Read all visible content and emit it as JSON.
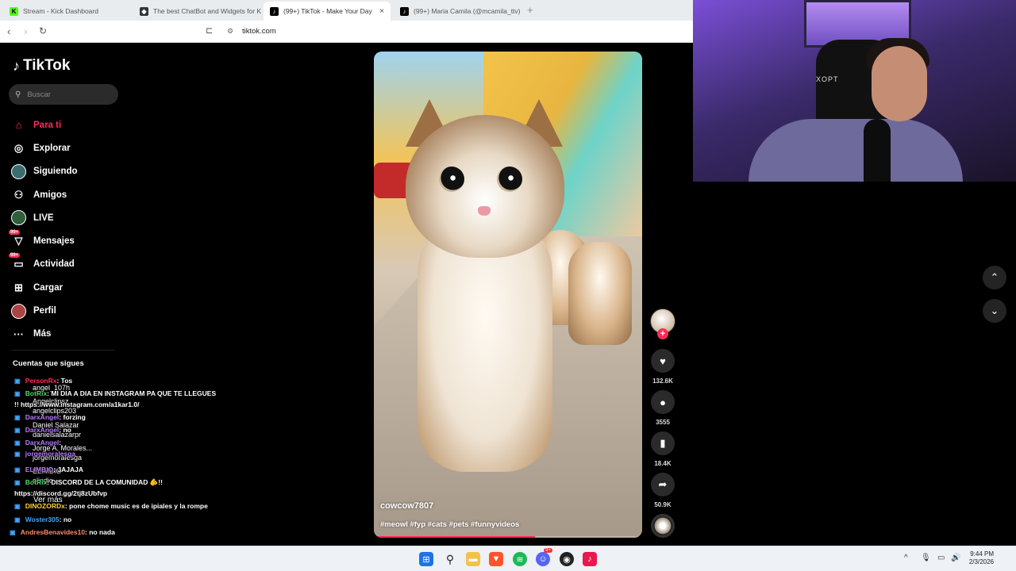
{
  "browser": {
    "tabs": [
      {
        "title": "Stream - Kick Dashboard",
        "favicon": "kick-icon",
        "active": false
      },
      {
        "title": "The best ChatBot and Widgets for K",
        "favicon": "botrix-icon",
        "active": false
      },
      {
        "title": "(99+) TikTok - Make Your Day",
        "favicon": "tiktok-icon",
        "active": true
      },
      {
        "title": "(99+) Maria Camila (@mcamila_ttv) |",
        "favicon": "tiktok-icon",
        "active": false
      }
    ],
    "new_tab": "+",
    "close_glyph": "×",
    "url": "tiktok.com"
  },
  "sidebar": {
    "logo_text": "TikTok",
    "search_placeholder": "Buscar",
    "items": [
      {
        "label": "Para ti",
        "icon": "home-icon",
        "active": true
      },
      {
        "label": "Explorar",
        "icon": "compass-icon"
      },
      {
        "label": "Siguiendo",
        "icon": "following-avatar-icon"
      },
      {
        "label": "Amigos",
        "icon": "friends-icon"
      },
      {
        "label": "LIVE",
        "icon": "live-avatar-icon"
      },
      {
        "label": "Mensajes",
        "icon": "messages-icon",
        "badge": "99+"
      },
      {
        "label": "Actividad",
        "icon": "activity-icon",
        "badge": "99+"
      },
      {
        "label": "Cargar",
        "icon": "upload-icon"
      },
      {
        "label": "Perfil",
        "icon": "profile-avatar-icon"
      },
      {
        "label": "Más",
        "icon": "more-icon"
      }
    ],
    "following_title": "Cuentas que sigues",
    "see_more": "Ver más"
  },
  "following_overlay": [
    "angel_107h",
    "Angelclipsz",
    "angelclips203",
    "Daniel Salazar",
    "danielsalazarpr",
    "Jorge A. Morales...",
    "jorgemoralesga",
    "ELIMBIO",
    "elindio"
  ],
  "chat": [
    {
      "user": "PersonRx",
      "user_color": "#fe2c55",
      "text": ": Tos"
    },
    {
      "user": "BotRix",
      "user_color": "#53d769",
      "text": ": MI DIA A DIA EN INSTAGRAM PA QUE TE LLEGUES"
    },
    {
      "user": "",
      "user_color": "#ffffff",
      "text": "!! https://www.instagram.com/a1kar1.0/"
    },
    {
      "user": "DarxAngel",
      "user_color": "#b57bff",
      "text": ": forzing"
    },
    {
      "user": "DarxAngel",
      "user_color": "#b57bff",
      "text": ": no"
    },
    {
      "user": "DarxAngel",
      "user_color": "#b57bff",
      "text": ":"
    },
    {
      "user": "jorgemoralesga",
      "user_color": "#b57bff",
      "text": ""
    },
    {
      "user": "ELIMBIO",
      "user_color": "#b57bff",
      "text": ": JAJAJA"
    },
    {
      "user": "BotRix",
      "user_color": "#53d769",
      "text": ": DISCORD DE LA COMUNIDAD 🫵!!"
    },
    {
      "user": "",
      "user_color": "#ffffff",
      "text": "https://discord.gg/2tj8zUbfvp"
    },
    {
      "user": "DINOZORDx",
      "user_color": "#ffd23f",
      "text": ": pone chome music es de ipiales y la rompe"
    },
    {
      "user": "Woster305",
      "user_color": "#3fa7ff",
      "text": ": no"
    },
    {
      "user": "AndresBenavides10",
      "user_color": "#ff8c6b",
      "text": ": no nada"
    }
  ],
  "video": {
    "author": "cowcow7807",
    "tags": "#meowl #fyp #cats #pets #funnyvideos",
    "progress": 0.6
  },
  "actions": {
    "likes": "132.6K",
    "comments": "3555",
    "saves": "18.4K",
    "shares": "50.9K",
    "follow_plus": "+"
  },
  "webcam": {
    "overlay_logo": "XOPT"
  },
  "taskbar": {
    "time": "9:44 PM",
    "date": "2/3/2026",
    "apps": [
      "windows-start-icon",
      "search-icon",
      "file-explorer-icon",
      "brave-icon",
      "spotify-icon",
      "discord-icon",
      "obs-icon",
      "tiktok-icon"
    ],
    "discord_badge": "9+"
  },
  "colors": {
    "accent": "#fe2c55",
    "background": "#000000"
  }
}
